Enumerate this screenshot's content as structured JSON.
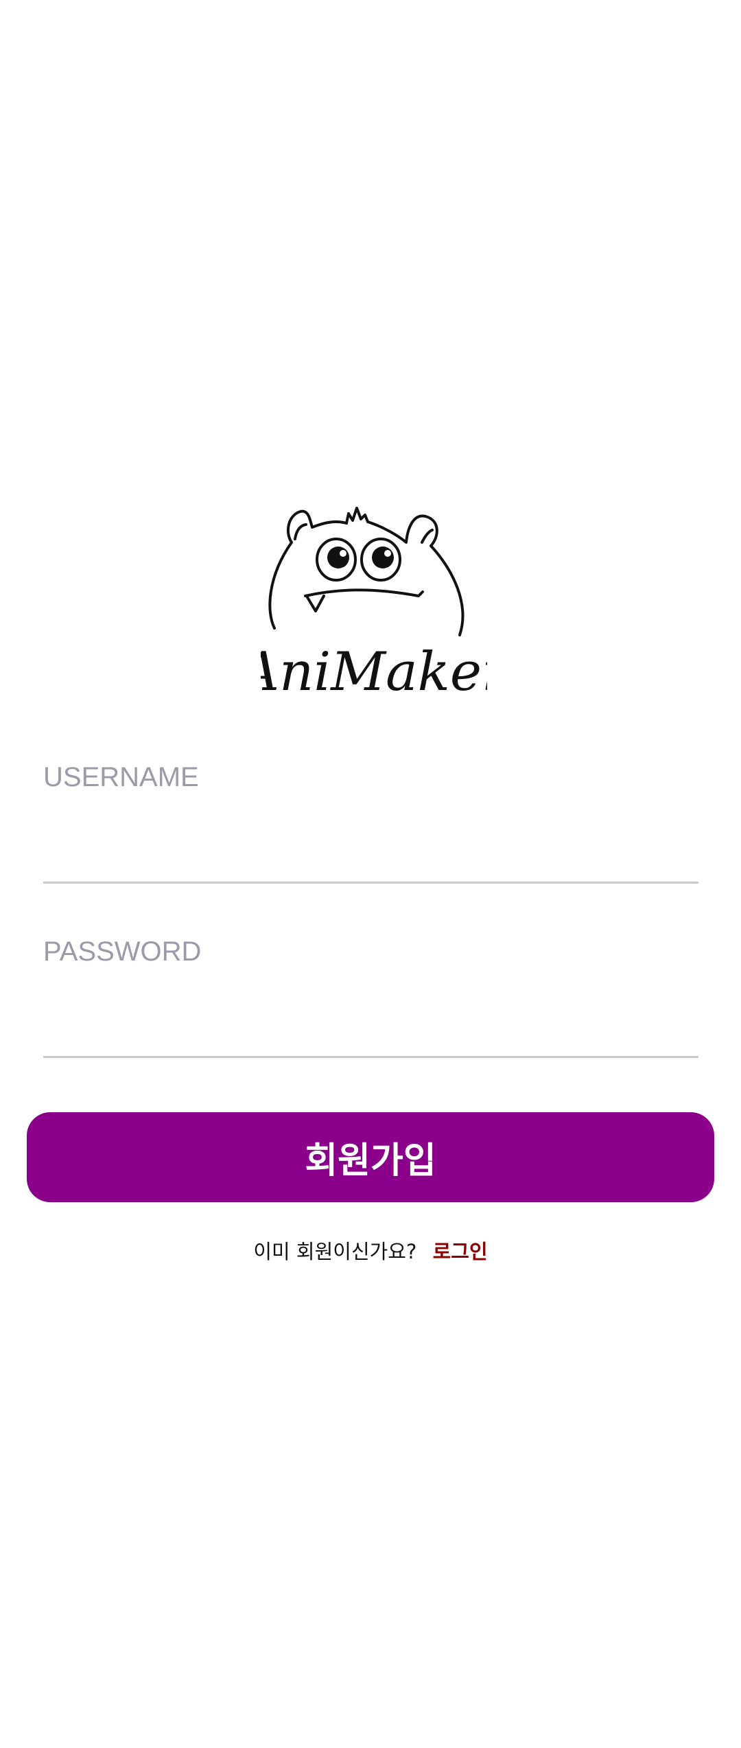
{
  "logo": {
    "icon": "monster-icon",
    "wordmark": "AniMaker"
  },
  "form": {
    "username_label": "USERNAME",
    "username_value": "",
    "password_label": "PASSWORD",
    "password_value": ""
  },
  "actions": {
    "signup_label": "회원가입",
    "login_prompt": "이미 회원이신가요?",
    "login_link": "로그인"
  },
  "colors": {
    "primary": "#8b008b",
    "link": "#8b0000",
    "label": "#9a9aa8",
    "underline": "#c9c9cf"
  }
}
